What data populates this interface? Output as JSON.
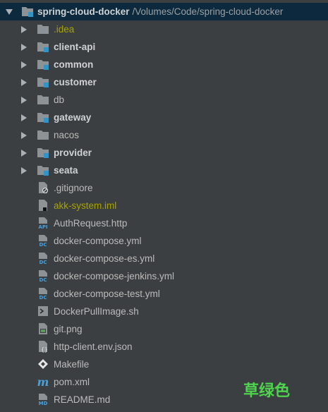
{
  "project": {
    "name": "spring-cloud-docker",
    "path": "/Volumes/Code/spring-cloud-docker"
  },
  "folders": [
    {
      "name": ".idea",
      "style": "ignored",
      "module": false
    },
    {
      "name": "client-api",
      "style": "bold",
      "module": true
    },
    {
      "name": "common",
      "style": "bold",
      "module": true
    },
    {
      "name": "customer",
      "style": "bold",
      "module": true
    },
    {
      "name": "db",
      "style": "plain",
      "module": false
    },
    {
      "name": "gateway",
      "style": "bold",
      "module": true
    },
    {
      "name": "nacos",
      "style": "plain",
      "module": false
    },
    {
      "name": "provider",
      "style": "bold",
      "module": true
    },
    {
      "name": "seata",
      "style": "bold",
      "module": true
    }
  ],
  "files": [
    {
      "name": ".gitignore",
      "icon": "gitignore-icon",
      "style": "plain"
    },
    {
      "name": "akk-system.iml",
      "icon": "iml-icon",
      "style": "ignored"
    },
    {
      "name": "AuthRequest.http",
      "icon": "api-icon",
      "style": "plain"
    },
    {
      "name": "docker-compose.yml",
      "icon": "docker-compose-icon",
      "style": "plain"
    },
    {
      "name": "docker-compose-es.yml",
      "icon": "docker-compose-icon",
      "style": "plain"
    },
    {
      "name": "docker-compose-jenkins.yml",
      "icon": "docker-compose-icon",
      "style": "plain"
    },
    {
      "name": "docker-compose-test.yml",
      "icon": "docker-compose-icon",
      "style": "plain"
    },
    {
      "name": "DockerPullImage.sh",
      "icon": "shell-script-icon",
      "style": "plain"
    },
    {
      "name": "git.png",
      "icon": "image-file-icon",
      "style": "plain"
    },
    {
      "name": "http-client.env.json",
      "icon": "json-file-icon",
      "style": "plain"
    },
    {
      "name": "Makefile",
      "icon": "makefile-icon",
      "style": "plain"
    },
    {
      "name": "pom.xml",
      "icon": "maven-icon",
      "style": "plain"
    },
    {
      "name": "README.md",
      "icon": "markdown-icon",
      "style": "plain"
    }
  ],
  "watermark": "草绿色",
  "colors": {
    "background": "#3c3f41",
    "selected_row": "#0d293e",
    "ignored_text": "#a8a300",
    "folder_icon": "#8c9296",
    "module_badge": "#3592c4",
    "watermark": "#4fd34f"
  }
}
